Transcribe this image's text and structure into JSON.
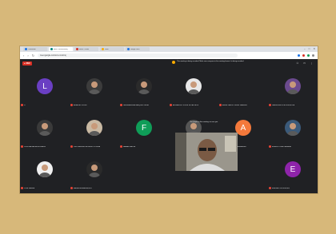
{
  "browser": {
    "tabs": [
      {
        "title": "Classroom",
        "color": "#1a73e8",
        "active": false
      },
      {
        "title": "Meet - xzo-ncnd-hsj",
        "color": "#00897b",
        "active": true
      },
      {
        "title": "Inbox - Gmail",
        "color": "#d93025",
        "active": false
      },
      {
        "title": "Drive",
        "color": "#f9ab00",
        "active": false
      },
      {
        "title": "Google Docs",
        "color": "#1a73e8",
        "active": false
      }
    ],
    "url": "meet.google.com/xzo-ncnd-hsj",
    "controls": {
      "minimize": "–",
      "maximize": "□",
      "close": "✕"
    }
  },
  "meeting": {
    "recording_label": "REC",
    "notice": "This meeting is being recorded. Make sure everyone in the meeting knows it is being recorded.",
    "caption": "The people in this meeting can see you.",
    "top_icons": [
      "people-icon",
      "chat-icon",
      "activities-icon"
    ],
    "participants": [
      {
        "initial": "L",
        "name": "Li",
        "bg": "#6a3fc3",
        "kind": "letter"
      },
      {
        "initial": "",
        "name": "ARIADNE TELLEZ",
        "bg": "#3c3c3c",
        "kind": "photo"
      },
      {
        "initial": "",
        "name": "LAURA ANDREA VASQUEZ PEREZ",
        "bg": "#2b2b2b",
        "kind": "photo"
      },
      {
        "initial": "",
        "name": "ALEJANDRO JOSUE VILLALOBOS",
        "bg": "#e8e8e8",
        "kind": "photo"
      },
      {
        "initial": "",
        "name": "ANGEL MATEO PEREZ RAMIREZ",
        "bg": "#202124",
        "kind": "blank"
      },
      {
        "initial": "",
        "name": "DANIELA MONTES ESPINOZA",
        "bg": "#6b4a8e",
        "kind": "photo"
      },
      {
        "initial": "",
        "name": "CRISTINA JAZMIN MORALES",
        "bg": "#3a3a3a",
        "kind": "photo"
      },
      {
        "initial": "",
        "name": "JULIO ANDRES MORENO ORTEGA",
        "bg": "#c9b9a3",
        "kind": "photo"
      },
      {
        "initial": "F",
        "name": "FABIAN GARCIA",
        "bg": "#0f9d58",
        "kind": "letter"
      },
      {
        "initial": "",
        "name": "",
        "bg": "#555555",
        "kind": "photo"
      },
      {
        "initial": "A",
        "name": "ALEX FERNANDO HERNANDEZ",
        "bg": "#f4793b",
        "kind": "letter"
      },
      {
        "initial": "",
        "name": "ERNESTO DIAZ SALAZAR",
        "bg": "#3b5a7a",
        "kind": "photo"
      },
      {
        "initial": "",
        "name": "JOSE ZAPATA",
        "bg": "#f0f0f0",
        "kind": "photo"
      },
      {
        "initial": "",
        "name": "MARIA FERNANDA RUIZ",
        "bg": "#2a2a2a",
        "kind": "photo"
      },
      {
        "initial": "",
        "name": "",
        "bg": "#202124",
        "kind": "blank"
      },
      {
        "initial": "",
        "name": "",
        "bg": "#202124",
        "kind": "blank"
      },
      {
        "initial": "",
        "name": "",
        "bg": "#202124",
        "kind": "blank"
      },
      {
        "initial": "E",
        "name": "EMILIANO RODRIGUEZ",
        "bg": "#8e24aa",
        "kind": "letter"
      }
    ]
  }
}
